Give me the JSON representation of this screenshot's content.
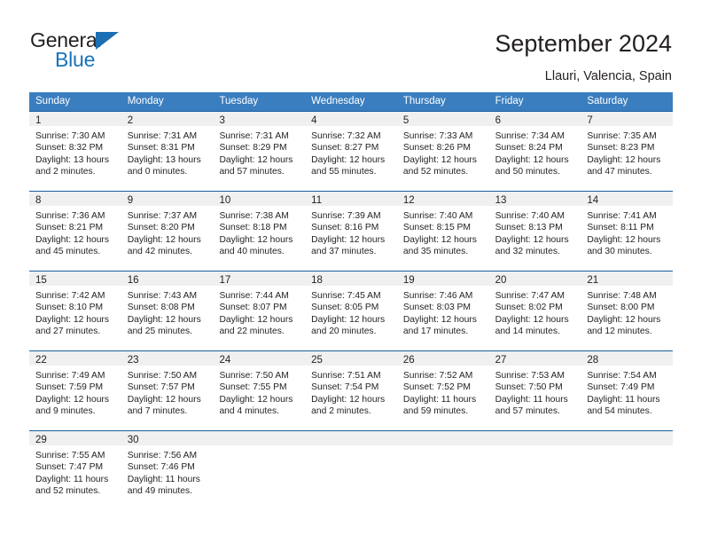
{
  "brand": {
    "name_part1": "General",
    "name_part2": "Blue",
    "triangle_color": "#1b6fb4"
  },
  "header": {
    "title": "September 2024",
    "location": "Llauri, Valencia, Spain"
  },
  "theme": {
    "header_bg": "#3a7ebf",
    "row_rule": "#1b5e9e",
    "daynum_band": "#f0f0f0",
    "text": "#231f20"
  },
  "weekdays": [
    "Sunday",
    "Monday",
    "Tuesday",
    "Wednesday",
    "Thursday",
    "Friday",
    "Saturday"
  ],
  "weeks": [
    [
      {
        "day": "1",
        "sunrise": "Sunrise: 7:30 AM",
        "sunset": "Sunset: 8:32 PM",
        "daylight1": "Daylight: 13 hours",
        "daylight2": "and 2 minutes."
      },
      {
        "day": "2",
        "sunrise": "Sunrise: 7:31 AM",
        "sunset": "Sunset: 8:31 PM",
        "daylight1": "Daylight: 13 hours",
        "daylight2": "and 0 minutes."
      },
      {
        "day": "3",
        "sunrise": "Sunrise: 7:31 AM",
        "sunset": "Sunset: 8:29 PM",
        "daylight1": "Daylight: 12 hours",
        "daylight2": "and 57 minutes."
      },
      {
        "day": "4",
        "sunrise": "Sunrise: 7:32 AM",
        "sunset": "Sunset: 8:27 PM",
        "daylight1": "Daylight: 12 hours",
        "daylight2": "and 55 minutes."
      },
      {
        "day": "5",
        "sunrise": "Sunrise: 7:33 AM",
        "sunset": "Sunset: 8:26 PM",
        "daylight1": "Daylight: 12 hours",
        "daylight2": "and 52 minutes."
      },
      {
        "day": "6",
        "sunrise": "Sunrise: 7:34 AM",
        "sunset": "Sunset: 8:24 PM",
        "daylight1": "Daylight: 12 hours",
        "daylight2": "and 50 minutes."
      },
      {
        "day": "7",
        "sunrise": "Sunrise: 7:35 AM",
        "sunset": "Sunset: 8:23 PM",
        "daylight1": "Daylight: 12 hours",
        "daylight2": "and 47 minutes."
      }
    ],
    [
      {
        "day": "8",
        "sunrise": "Sunrise: 7:36 AM",
        "sunset": "Sunset: 8:21 PM",
        "daylight1": "Daylight: 12 hours",
        "daylight2": "and 45 minutes."
      },
      {
        "day": "9",
        "sunrise": "Sunrise: 7:37 AM",
        "sunset": "Sunset: 8:20 PM",
        "daylight1": "Daylight: 12 hours",
        "daylight2": "and 42 minutes."
      },
      {
        "day": "10",
        "sunrise": "Sunrise: 7:38 AM",
        "sunset": "Sunset: 8:18 PM",
        "daylight1": "Daylight: 12 hours",
        "daylight2": "and 40 minutes."
      },
      {
        "day": "11",
        "sunrise": "Sunrise: 7:39 AM",
        "sunset": "Sunset: 8:16 PM",
        "daylight1": "Daylight: 12 hours",
        "daylight2": "and 37 minutes."
      },
      {
        "day": "12",
        "sunrise": "Sunrise: 7:40 AM",
        "sunset": "Sunset: 8:15 PM",
        "daylight1": "Daylight: 12 hours",
        "daylight2": "and 35 minutes."
      },
      {
        "day": "13",
        "sunrise": "Sunrise: 7:40 AM",
        "sunset": "Sunset: 8:13 PM",
        "daylight1": "Daylight: 12 hours",
        "daylight2": "and 32 minutes."
      },
      {
        "day": "14",
        "sunrise": "Sunrise: 7:41 AM",
        "sunset": "Sunset: 8:11 PM",
        "daylight1": "Daylight: 12 hours",
        "daylight2": "and 30 minutes."
      }
    ],
    [
      {
        "day": "15",
        "sunrise": "Sunrise: 7:42 AM",
        "sunset": "Sunset: 8:10 PM",
        "daylight1": "Daylight: 12 hours",
        "daylight2": "and 27 minutes."
      },
      {
        "day": "16",
        "sunrise": "Sunrise: 7:43 AM",
        "sunset": "Sunset: 8:08 PM",
        "daylight1": "Daylight: 12 hours",
        "daylight2": "and 25 minutes."
      },
      {
        "day": "17",
        "sunrise": "Sunrise: 7:44 AM",
        "sunset": "Sunset: 8:07 PM",
        "daylight1": "Daylight: 12 hours",
        "daylight2": "and 22 minutes."
      },
      {
        "day": "18",
        "sunrise": "Sunrise: 7:45 AM",
        "sunset": "Sunset: 8:05 PM",
        "daylight1": "Daylight: 12 hours",
        "daylight2": "and 20 minutes."
      },
      {
        "day": "19",
        "sunrise": "Sunrise: 7:46 AM",
        "sunset": "Sunset: 8:03 PM",
        "daylight1": "Daylight: 12 hours",
        "daylight2": "and 17 minutes."
      },
      {
        "day": "20",
        "sunrise": "Sunrise: 7:47 AM",
        "sunset": "Sunset: 8:02 PM",
        "daylight1": "Daylight: 12 hours",
        "daylight2": "and 14 minutes."
      },
      {
        "day": "21",
        "sunrise": "Sunrise: 7:48 AM",
        "sunset": "Sunset: 8:00 PM",
        "daylight1": "Daylight: 12 hours",
        "daylight2": "and 12 minutes."
      }
    ],
    [
      {
        "day": "22",
        "sunrise": "Sunrise: 7:49 AM",
        "sunset": "Sunset: 7:59 PM",
        "daylight1": "Daylight: 12 hours",
        "daylight2": "and 9 minutes."
      },
      {
        "day": "23",
        "sunrise": "Sunrise: 7:50 AM",
        "sunset": "Sunset: 7:57 PM",
        "daylight1": "Daylight: 12 hours",
        "daylight2": "and 7 minutes."
      },
      {
        "day": "24",
        "sunrise": "Sunrise: 7:50 AM",
        "sunset": "Sunset: 7:55 PM",
        "daylight1": "Daylight: 12 hours",
        "daylight2": "and 4 minutes."
      },
      {
        "day": "25",
        "sunrise": "Sunrise: 7:51 AM",
        "sunset": "Sunset: 7:54 PM",
        "daylight1": "Daylight: 12 hours",
        "daylight2": "and 2 minutes."
      },
      {
        "day": "26",
        "sunrise": "Sunrise: 7:52 AM",
        "sunset": "Sunset: 7:52 PM",
        "daylight1": "Daylight: 11 hours",
        "daylight2": "and 59 minutes."
      },
      {
        "day": "27",
        "sunrise": "Sunrise: 7:53 AM",
        "sunset": "Sunset: 7:50 PM",
        "daylight1": "Daylight: 11 hours",
        "daylight2": "and 57 minutes."
      },
      {
        "day": "28",
        "sunrise": "Sunrise: 7:54 AM",
        "sunset": "Sunset: 7:49 PM",
        "daylight1": "Daylight: 11 hours",
        "daylight2": "and 54 minutes."
      }
    ],
    [
      {
        "day": "29",
        "sunrise": "Sunrise: 7:55 AM",
        "sunset": "Sunset: 7:47 PM",
        "daylight1": "Daylight: 11 hours",
        "daylight2": "and 52 minutes."
      },
      {
        "day": "30",
        "sunrise": "Sunrise: 7:56 AM",
        "sunset": "Sunset: 7:46 PM",
        "daylight1": "Daylight: 11 hours",
        "daylight2": "and 49 minutes."
      },
      {
        "day": "",
        "sunrise": "",
        "sunset": "",
        "daylight1": "",
        "daylight2": ""
      },
      {
        "day": "",
        "sunrise": "",
        "sunset": "",
        "daylight1": "",
        "daylight2": ""
      },
      {
        "day": "",
        "sunrise": "",
        "sunset": "",
        "daylight1": "",
        "daylight2": ""
      },
      {
        "day": "",
        "sunrise": "",
        "sunset": "",
        "daylight1": "",
        "daylight2": ""
      },
      {
        "day": "",
        "sunrise": "",
        "sunset": "",
        "daylight1": "",
        "daylight2": ""
      }
    ]
  ]
}
